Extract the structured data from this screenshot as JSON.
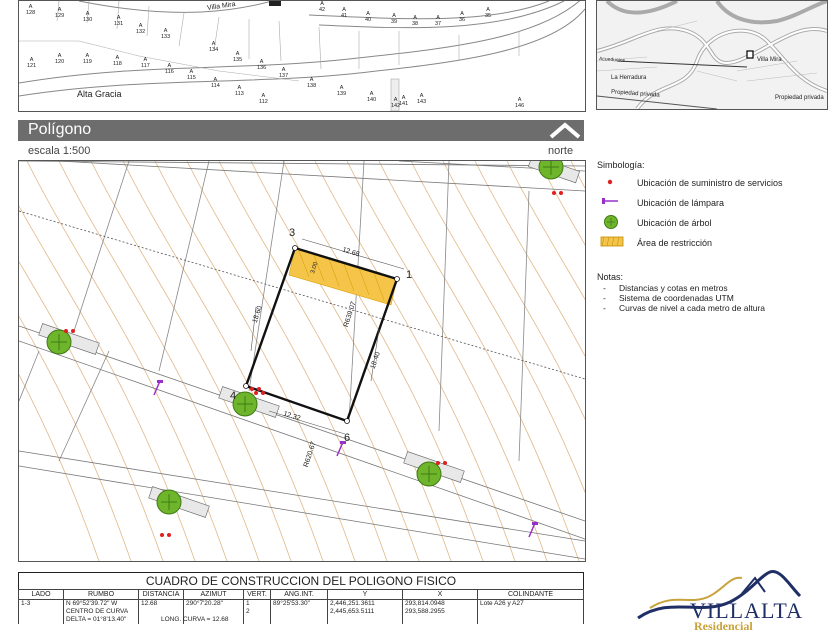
{
  "top_map": {
    "lots_upper": [
      "128",
      "129",
      "130",
      "131",
      "132",
      "133",
      "134",
      "135",
      "136",
      "137",
      "138",
      "139",
      "140",
      "141",
      "142",
      "143",
      "146"
    ],
    "lots_a_row": [
      "42",
      "41",
      "40",
      "39",
      "38",
      "37",
      "36",
      "35"
    ],
    "lots_left": [
      "121",
      "120",
      "119",
      "118",
      "117",
      "116",
      "115",
      "114",
      "113",
      "112"
    ],
    "lot_prefix": "A",
    "street_top": "Villa Mira",
    "street_bottom": "Alta Gracia"
  },
  "location_map": {
    "street_1": "Acueductos",
    "street_2": "Villa Mira",
    "street_3": "La Herradura",
    "label_private_1": "Propiedad privada",
    "label_private_2": "Propiedad privada"
  },
  "section": {
    "title": "Polígono",
    "scale": "escala 1:500",
    "north": "norte"
  },
  "plan": {
    "vertices": [
      "3",
      "1",
      "4",
      "6"
    ],
    "dimensions": [
      "12.68",
      "3.00",
      "18.60",
      "R639.07",
      "18.40",
      "12.32",
      "R620.67"
    ]
  },
  "legend": {
    "title": "Simbología:",
    "items": [
      {
        "label": "Ubicación de suministro de servicios",
        "icon": "service-dot-icon",
        "color": "#e02020"
      },
      {
        "label": "Ubicación de lámpara",
        "icon": "lamp-icon",
        "color": "#9b2fc9"
      },
      {
        "label": "Ubicación de árbol",
        "icon": "tree-icon",
        "color": "#6fb52c"
      },
      {
        "label": "Área de restricción",
        "icon": "restriction-area-icon",
        "color": "#f2c44a"
      }
    ]
  },
  "notes": {
    "title": "Notas:",
    "items": [
      "Distancias y cotas en metros",
      "Sistema de coordenadas UTM",
      "Curvas de nivel a cada metro de altura"
    ]
  },
  "table": {
    "caption": "CUADRO DE CONSTRUCCION DEL POLIGONO FISICO",
    "headers": [
      "LADO",
      "RUMBO",
      "DISTANCIA",
      "AZIMUT",
      "VERT.",
      "ANG.INT.",
      "Y",
      "X",
      "COLINDANTE"
    ],
    "row": {
      "lado": "1-3",
      "rumbo_1": "N 69°52'39.72\" W",
      "rumbo_2": "CENTRO DE CURVA",
      "rumbo_3": "DELTA = 01°8'13.40\"",
      "distancia": "12.68",
      "azimut": "290°7'20.28\"",
      "long_curva": "LONG. CURVA = 12.68",
      "vert_1": "1",
      "vert_2": "2",
      "ang_int": "89°25'53.30\"",
      "y_1": "2,446,251.3611",
      "y_2": "2,445,653.5111",
      "x_1": "293,814.0948",
      "x_2": "293,588.2955",
      "colindante": "Lote A26 y A27"
    }
  },
  "logo": {
    "brand": "VILLALTA",
    "sub": "Residencial",
    "colors": {
      "navy": "#1f2f66",
      "gold": "#c8a23a"
    }
  }
}
